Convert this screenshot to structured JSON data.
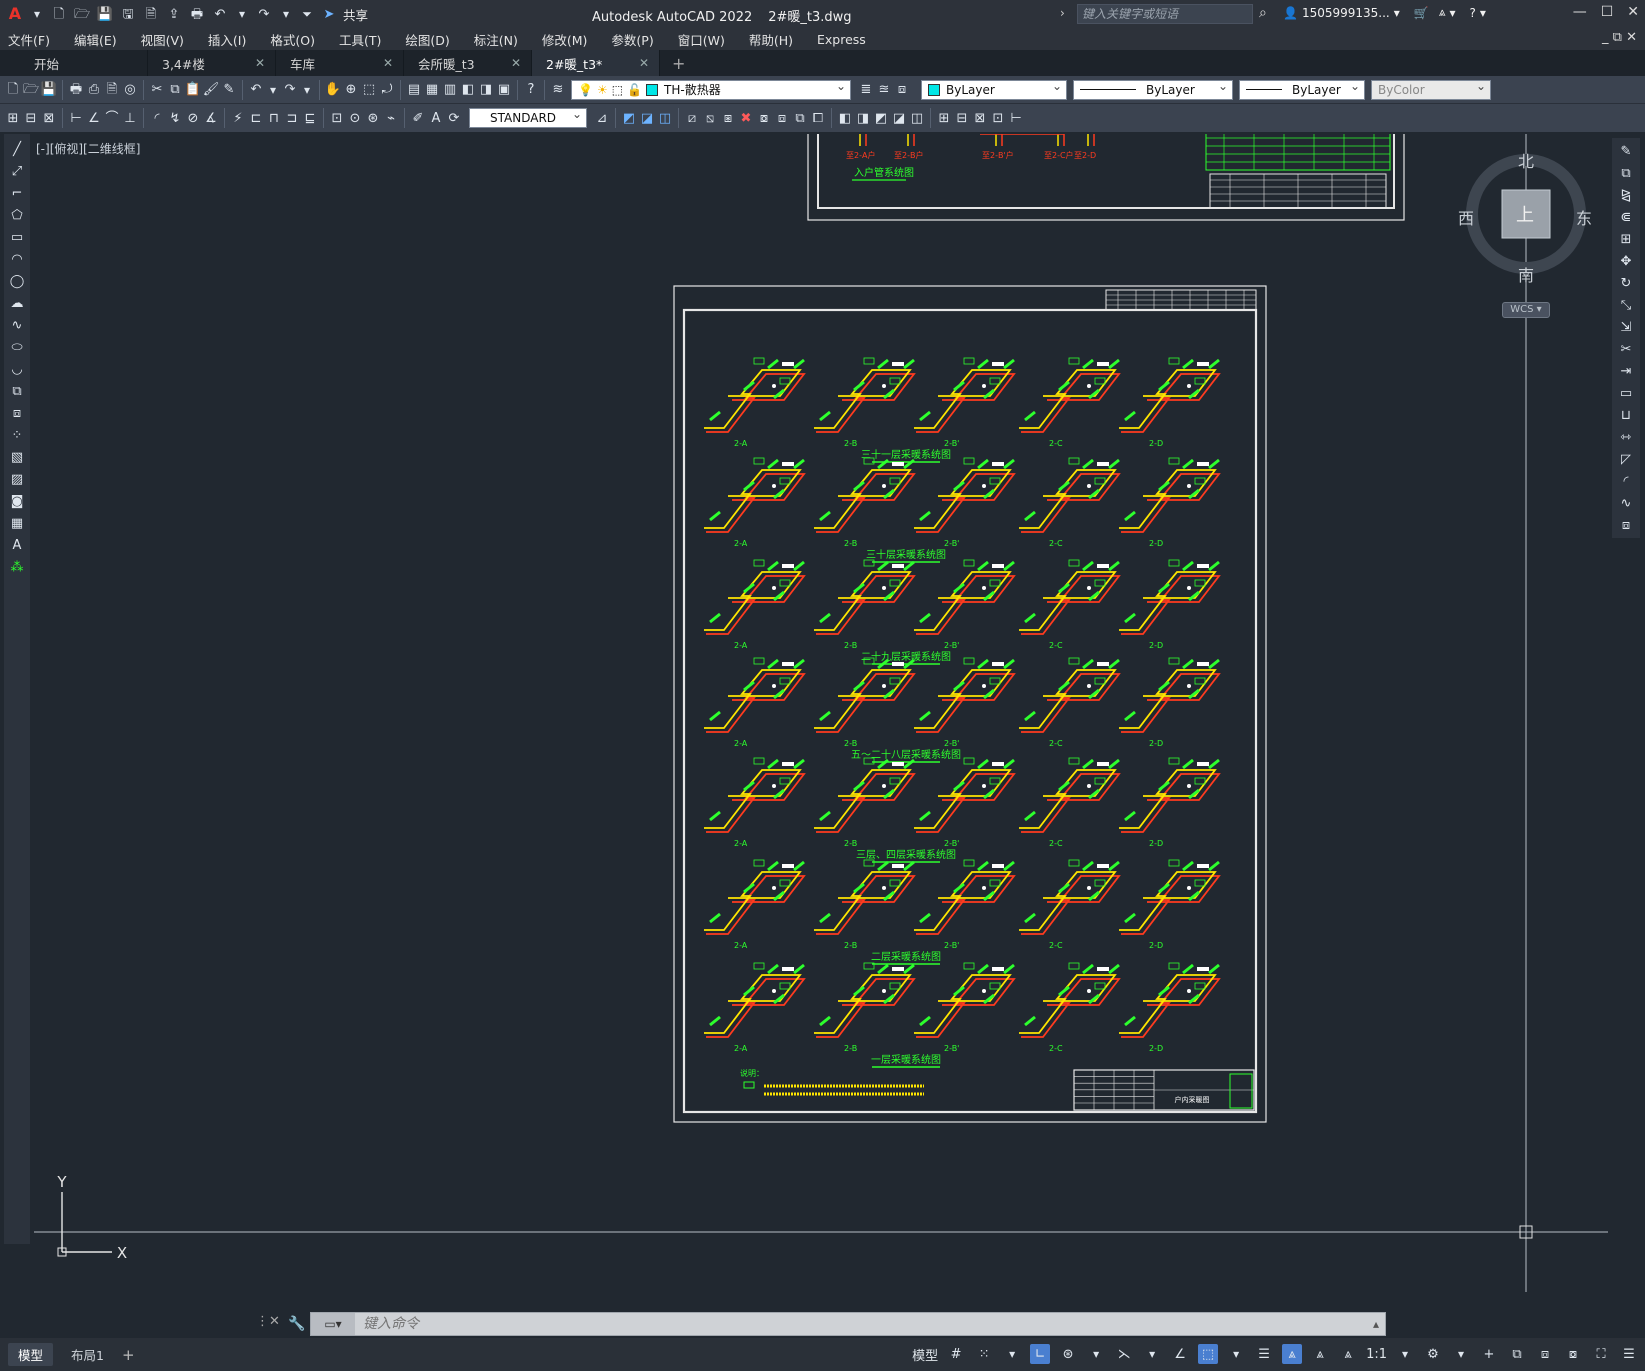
{
  "app": {
    "title": "Autodesk AutoCAD 2022",
    "document": "2#暖_t3.dwg",
    "share": "共享",
    "search_placeholder": "键入关键字或短语",
    "user": "1505999135..."
  },
  "menu": [
    "文件(F)",
    "编辑(E)",
    "视图(V)",
    "插入(I)",
    "格式(O)",
    "工具(T)",
    "绘图(D)",
    "标注(N)",
    "修改(M)",
    "参数(P)",
    "窗口(W)",
    "帮助(H)",
    "Express"
  ],
  "tabs": [
    {
      "label": "开始",
      "closable": false,
      "active": false
    },
    {
      "label": "3,4#楼",
      "closable": true,
      "active": false
    },
    {
      "label": "车库",
      "closable": true,
      "active": false
    },
    {
      "label": "会所暖_t3",
      "closable": true,
      "active": false
    },
    {
      "label": "2#暖_t3*",
      "closable": true,
      "active": true
    }
  ],
  "toolbar": {
    "layer": "TH-散热器",
    "color": "ByLayer",
    "linetype": "ByLayer",
    "lineweight": "ByLayer",
    "plotstyle": "ByColor",
    "textstyle": "STANDARD"
  },
  "viewport": {
    "label": "[-][俯视][二维线框]",
    "compass": {
      "north": "北",
      "south": "南",
      "east": "东",
      "west": "西",
      "center": "上"
    },
    "wcs": "WCS",
    "ucs": {
      "x": "X",
      "y": "Y"
    }
  },
  "drawing": {
    "top_sheet_label": "入户管系统图",
    "top_sheet_marks": [
      "至2-A户",
      "至2-B户",
      "至2-B'户",
      "至2-C户",
      "至2-D"
    ],
    "units": [
      "2-A",
      "2-B",
      "2-B'",
      "2-C",
      "2-D"
    ],
    "rows": [
      {
        "title": "三十一层采暖系统图"
      },
      {
        "title": "三十层采暖系统图"
      },
      {
        "title": "二十九层采暖系统图"
      },
      {
        "title": "五～二十八层采暖系统图"
      },
      {
        "title": "三层、四层采暖系统图"
      },
      {
        "title": "二层采暖系统图"
      },
      {
        "title": "一层采暖系统图"
      }
    ],
    "note_title": "说明：",
    "title_block_text": "户内采暖图"
  },
  "command": {
    "placeholder": "键入命令"
  },
  "status": {
    "layouts": [
      {
        "label": "模型",
        "active": true
      },
      {
        "label": "布局1",
        "active": false
      }
    ],
    "model": "模型",
    "scale": "1:1"
  },
  "colors": {
    "red": "#ff3b1f",
    "yellow": "#ffe600",
    "green": "#2dff2d",
    "white": "#ffffff"
  }
}
